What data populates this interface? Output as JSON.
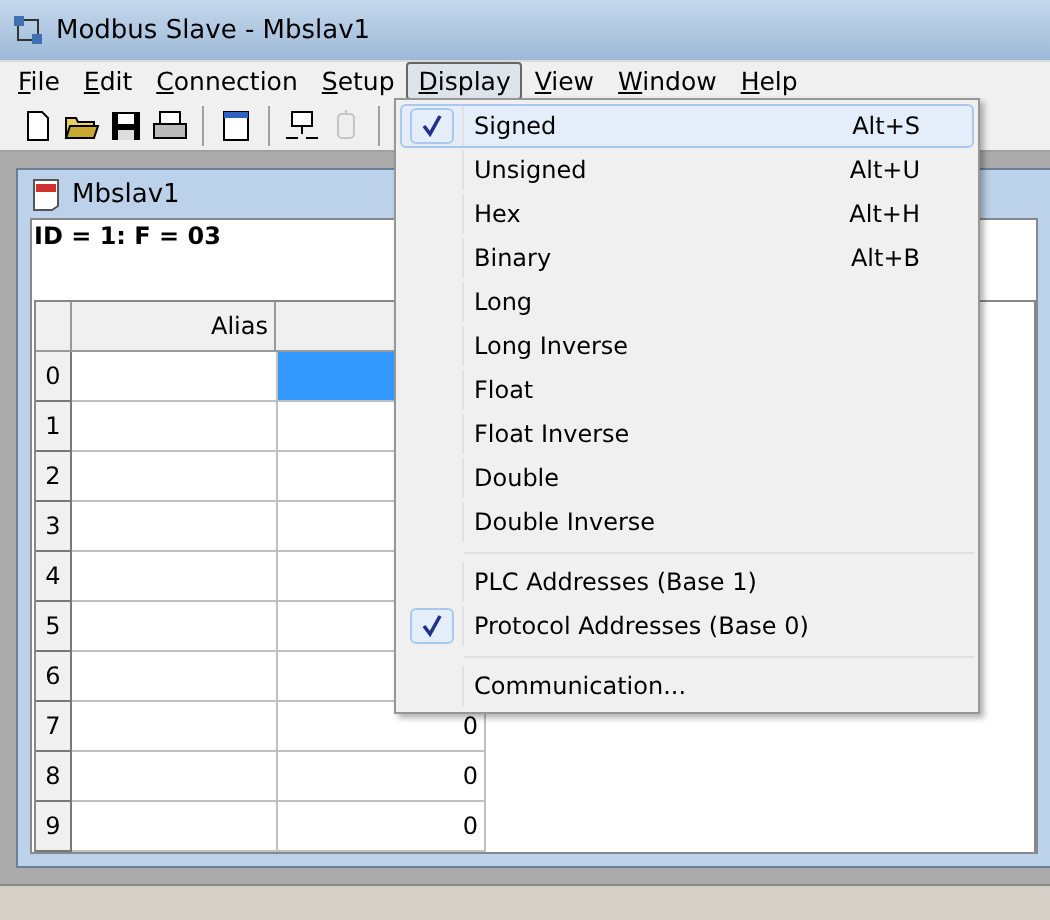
{
  "window": {
    "title": "Modbus Slave - Mbslav1"
  },
  "menubar": [
    {
      "label": "File",
      "open": false
    },
    {
      "label": "Edit",
      "open": false
    },
    {
      "label": "Connection",
      "open": false
    },
    {
      "label": "Setup",
      "open": false
    },
    {
      "label": "Display",
      "open": true
    },
    {
      "label": "View",
      "open": false
    },
    {
      "label": "Window",
      "open": false
    },
    {
      "label": "Help",
      "open": false
    }
  ],
  "toolbar": [
    {
      "kind": "new",
      "disabled": false
    },
    {
      "kind": "open",
      "disabled": false
    },
    {
      "kind": "save",
      "disabled": false
    },
    {
      "kind": "print",
      "disabled": false
    },
    {
      "kind": "sep"
    },
    {
      "kind": "window",
      "disabled": false
    },
    {
      "kind": "sep"
    },
    {
      "kind": "connect",
      "disabled": false
    },
    {
      "kind": "disconnect",
      "disabled": true
    },
    {
      "kind": "sep"
    }
  ],
  "child": {
    "title": "Mbslav1",
    "header": "ID = 1: F = 03",
    "columns": [
      "Alias"
    ],
    "rows": [
      {
        "index": "0",
        "selected": true
      },
      {
        "index": "1",
        "selected": false
      },
      {
        "index": "2",
        "selected": false
      },
      {
        "index": "3",
        "selected": false
      },
      {
        "index": "4",
        "selected": false
      },
      {
        "index": "5",
        "selected": false
      },
      {
        "index": "6",
        "selected": false
      },
      {
        "index": "7",
        "selected": false,
        "value": "0"
      },
      {
        "index": "8",
        "selected": false,
        "value": "0"
      },
      {
        "index": "9",
        "selected": false,
        "value": "0"
      }
    ]
  },
  "display_menu": [
    {
      "kind": "item",
      "label": "Signed",
      "shortcut": "Alt+S",
      "checked": true,
      "highlighted": true
    },
    {
      "kind": "item",
      "label": "Unsigned",
      "shortcut": "Alt+U",
      "checked": false,
      "highlighted": false
    },
    {
      "kind": "item",
      "label": "Hex",
      "shortcut": "Alt+H",
      "checked": false,
      "highlighted": false
    },
    {
      "kind": "item",
      "label": "Binary",
      "shortcut": "Alt+B",
      "checked": false,
      "highlighted": false
    },
    {
      "kind": "item",
      "label": "Long",
      "checked": false,
      "highlighted": false
    },
    {
      "kind": "item",
      "label": "Long Inverse",
      "checked": false,
      "highlighted": false
    },
    {
      "kind": "item",
      "label": "Float",
      "checked": false,
      "highlighted": false
    },
    {
      "kind": "item",
      "label": "Float Inverse",
      "checked": false,
      "highlighted": false
    },
    {
      "kind": "item",
      "label": "Double",
      "checked": false,
      "highlighted": false
    },
    {
      "kind": "item",
      "label": "Double Inverse",
      "checked": false,
      "highlighted": false
    },
    {
      "kind": "separator"
    },
    {
      "kind": "item",
      "label": "PLC Addresses (Base 1)",
      "checked": false,
      "highlighted": false
    },
    {
      "kind": "item",
      "label": "Protocol Addresses (Base 0)",
      "checked": true,
      "highlighted": false
    },
    {
      "kind": "separator"
    },
    {
      "kind": "item",
      "label": "Communication...",
      "checked": false,
      "highlighted": false
    }
  ]
}
